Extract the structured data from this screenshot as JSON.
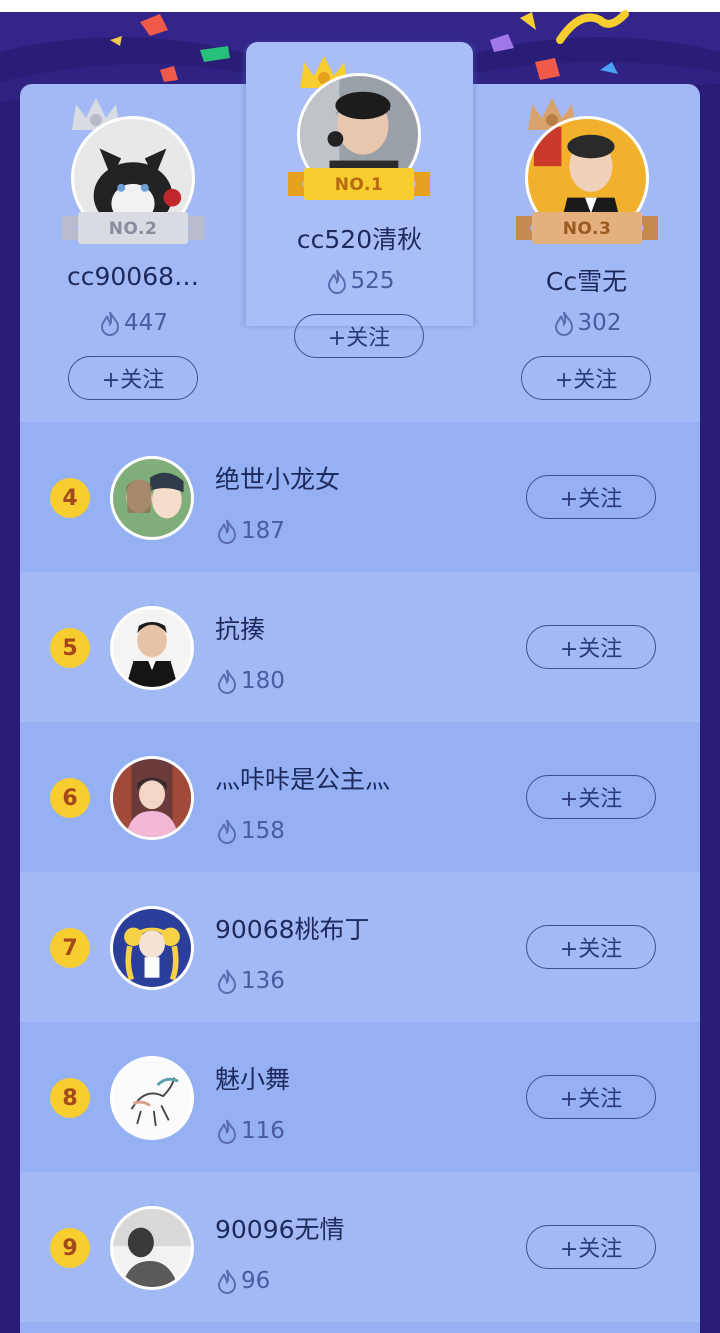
{
  "colors": {
    "background": "#2a1d78",
    "card": "#a3b9f5",
    "row_alt": "#95b0f3",
    "gold": "#f7cd2f",
    "silver": "#c7c9d2",
    "bronze": "#d8a36d",
    "text_primary": "#1f2a5c",
    "text_secondary": "#4a5ca0"
  },
  "podium": {
    "first": {
      "rank_label": "NO.1",
      "name": "cc520清秋",
      "score": "525",
      "follow_label": "+关注",
      "icon": "crown-gold-icon"
    },
    "second": {
      "rank_label": "NO.2",
      "name": "cc90068…",
      "score": "447",
      "follow_label": "+关注",
      "icon": "crown-silver-icon"
    },
    "third": {
      "rank_label": "NO.3",
      "name": "Cc雪无",
      "score": "302",
      "follow_label": "+关注",
      "icon": "crown-bronze-icon"
    }
  },
  "list": [
    {
      "rank": "4",
      "name": "绝世小龙女",
      "score": "187",
      "follow_label": "+关注"
    },
    {
      "rank": "5",
      "name": "抗揍",
      "score": "180",
      "follow_label": "+关注"
    },
    {
      "rank": "6",
      "name": "灬咔咔是公主灬",
      "score": "158",
      "follow_label": "+关注"
    },
    {
      "rank": "7",
      "name": "90068桃布丁",
      "score": "136",
      "follow_label": "+关注"
    },
    {
      "rank": "8",
      "name": "魅小舞",
      "score": "116",
      "follow_label": "+关注"
    },
    {
      "rank": "9",
      "name": "90096无情",
      "score": "96",
      "follow_label": "+关注"
    }
  ]
}
